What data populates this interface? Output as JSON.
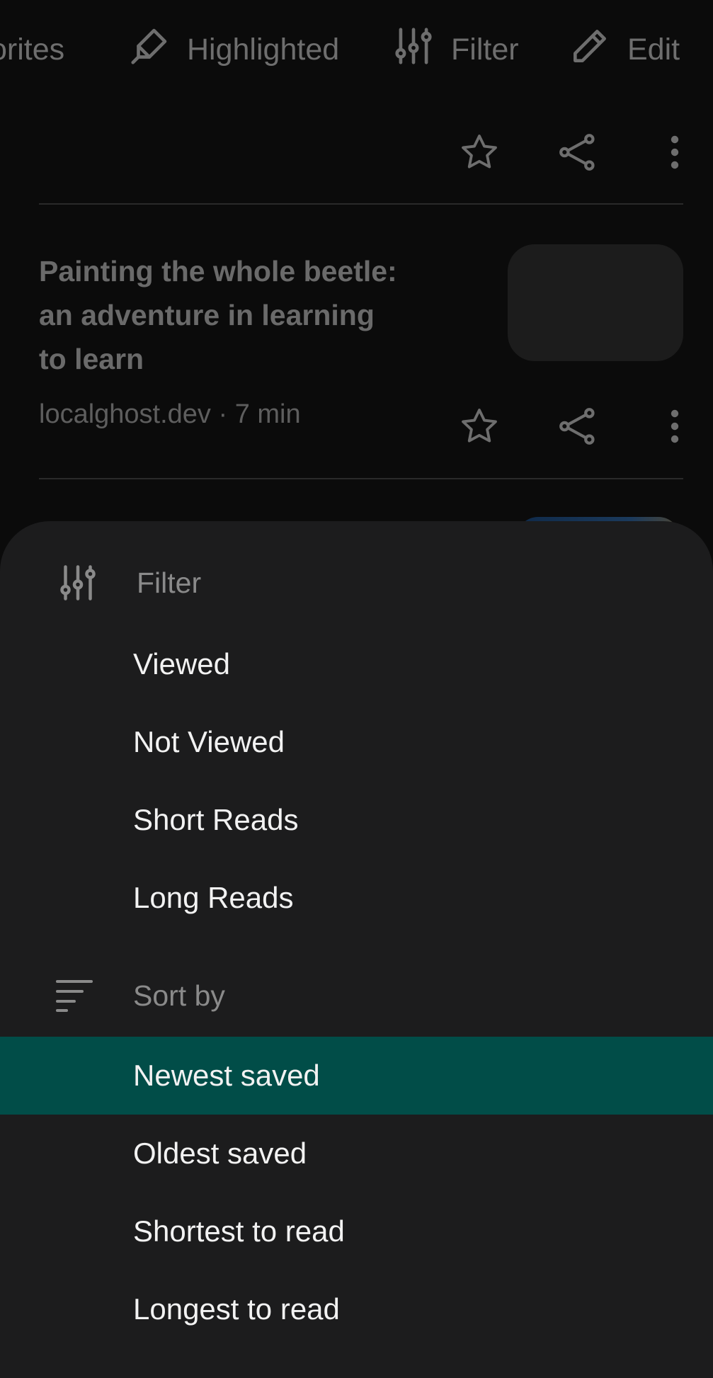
{
  "chips": {
    "favorites": "orites",
    "highlighted": "Highlighted",
    "filter": "Filter",
    "edit": "Edit"
  },
  "article": {
    "title": "Painting the whole beetle: an adventure in learning to learn",
    "meta": "localghost.dev · 7 min"
  },
  "sheet": {
    "filter_label": "Filter",
    "filter_options": [
      "Viewed",
      "Not Viewed",
      "Short Reads",
      "Long Reads"
    ],
    "sort_label": "Sort by",
    "sort_options": [
      "Newest saved",
      "Oldest saved",
      "Shortest to read",
      "Longest to read"
    ],
    "selected_sort": "Newest saved"
  },
  "colors": {
    "selected_bg": "#014d48",
    "sheet_bg": "#1c1c1d",
    "backdrop": "#0b0b0b"
  }
}
